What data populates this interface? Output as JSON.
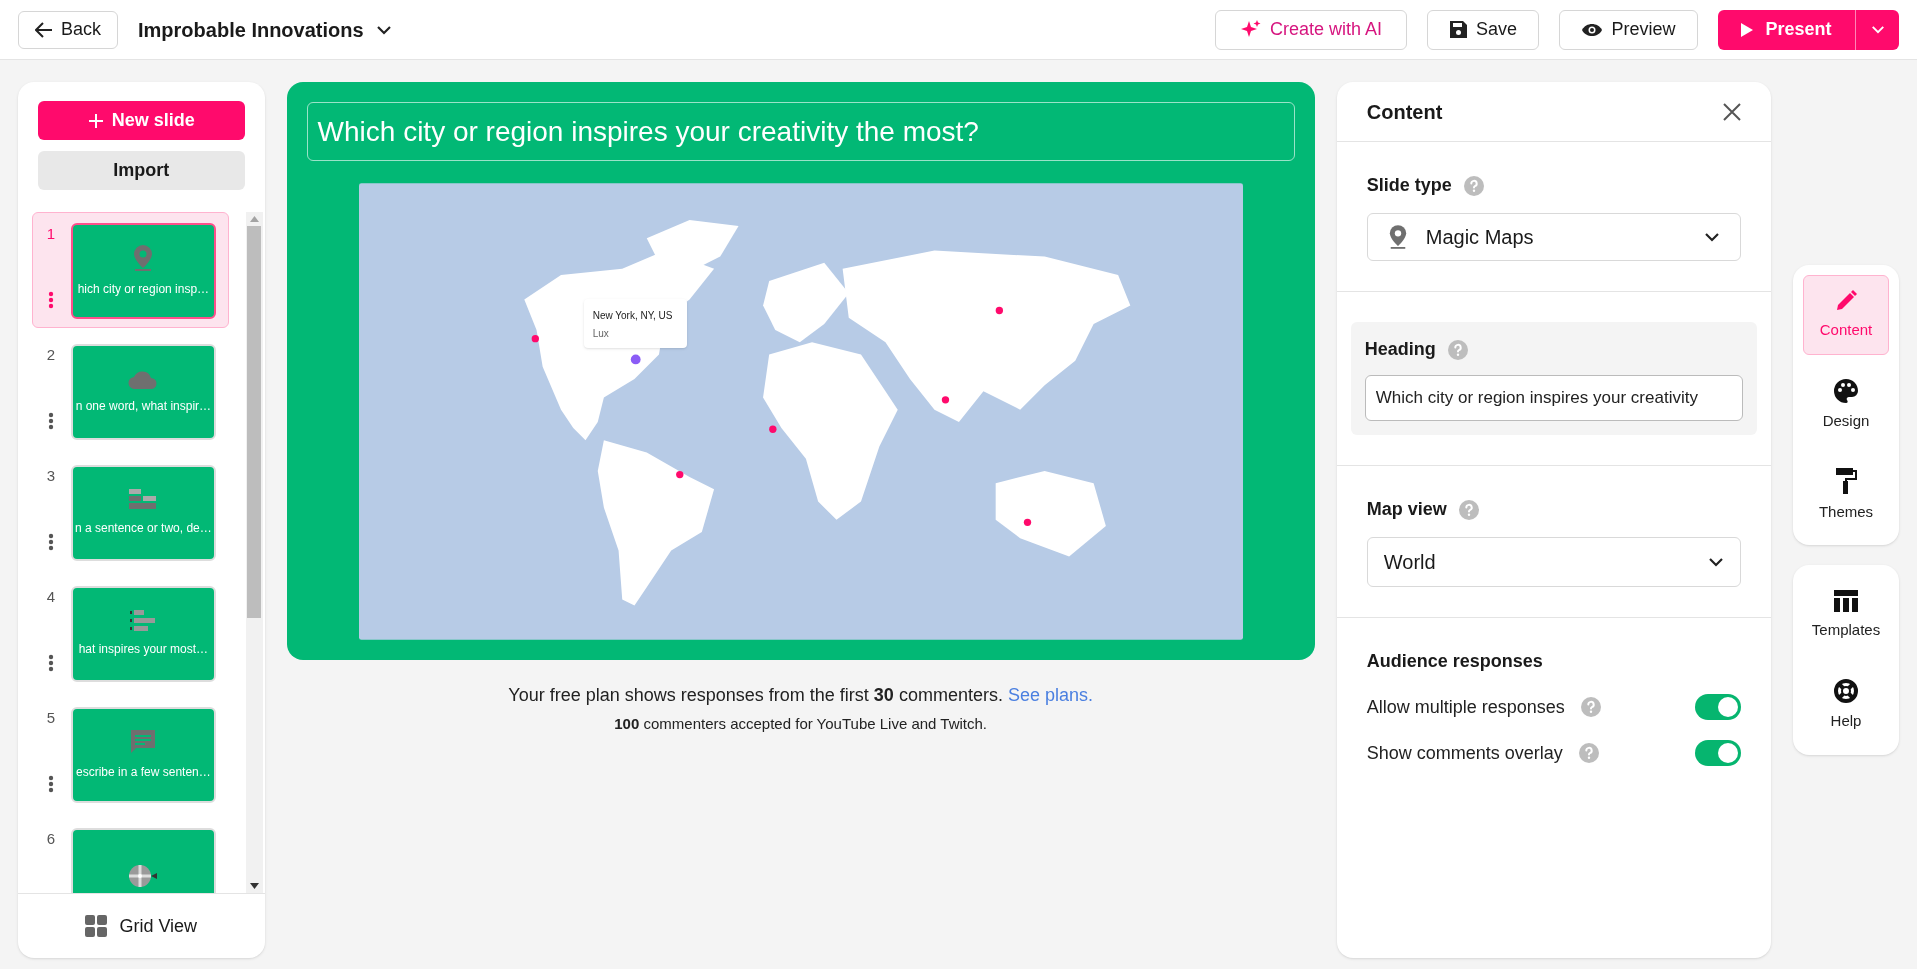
{
  "topbar": {
    "back": "Back",
    "title": "Improbable Innovations",
    "create_ai": "Create with AI",
    "save": "Save",
    "preview": "Preview",
    "present": "Present"
  },
  "sidebar": {
    "new_slide": "New slide",
    "import": "Import",
    "grid_view": "Grid View",
    "slides": [
      {
        "number": "1",
        "kind": "map",
        "text": "hich city or region insp…",
        "selected": true
      },
      {
        "number": "2",
        "kind": "cloud",
        "text": "n one word, what inspir…",
        "selected": false
      },
      {
        "number": "3",
        "kind": "bricks",
        "text": "n a sentence or two, de…",
        "selected": false
      },
      {
        "number": "4",
        "kind": "ranking",
        "text": "hat inspires your most…",
        "selected": false
      },
      {
        "number": "5",
        "kind": "chat",
        "text": "escribe in a few senten…",
        "selected": false
      },
      {
        "number": "6",
        "kind": "wheel",
        "selected": false
      }
    ]
  },
  "slide": {
    "heading": "Which city or region inspires your creativity the most?",
    "tooltip": {
      "place": "New York, NY, US",
      "name": "Lux"
    }
  },
  "notice": {
    "text": "Your free plan shows responses from the first **30** commenters.",
    "link": "See plans.",
    "sub": "**100** commenters accepted for YouTube Live and Twitch."
  },
  "panel": {
    "title": "Content",
    "slide_type_label": "Slide type",
    "slide_type": "Magic Maps",
    "heading_label": "Heading",
    "heading_value": "Which city or region inspires your creativity",
    "map_view_label": "Map view",
    "map_view": "World",
    "audience_title": "Audience responses",
    "toggles": [
      {
        "label": "Allow multiple responses",
        "checked": true
      },
      {
        "label": "Show comments overlay",
        "checked": true
      }
    ]
  },
  "rail": [
    {
      "label": "Content",
      "kind": "pencil",
      "selected": true
    },
    {
      "label": "Design",
      "kind": "palette",
      "selected": false
    },
    {
      "label": "Themes",
      "kind": "roller",
      "selected": false
    },
    {
      "label": "Templates",
      "kind": "table",
      "selected": false
    },
    {
      "label": "Help",
      "kind": "lifebuoy",
      "selected": false
    }
  ]
}
